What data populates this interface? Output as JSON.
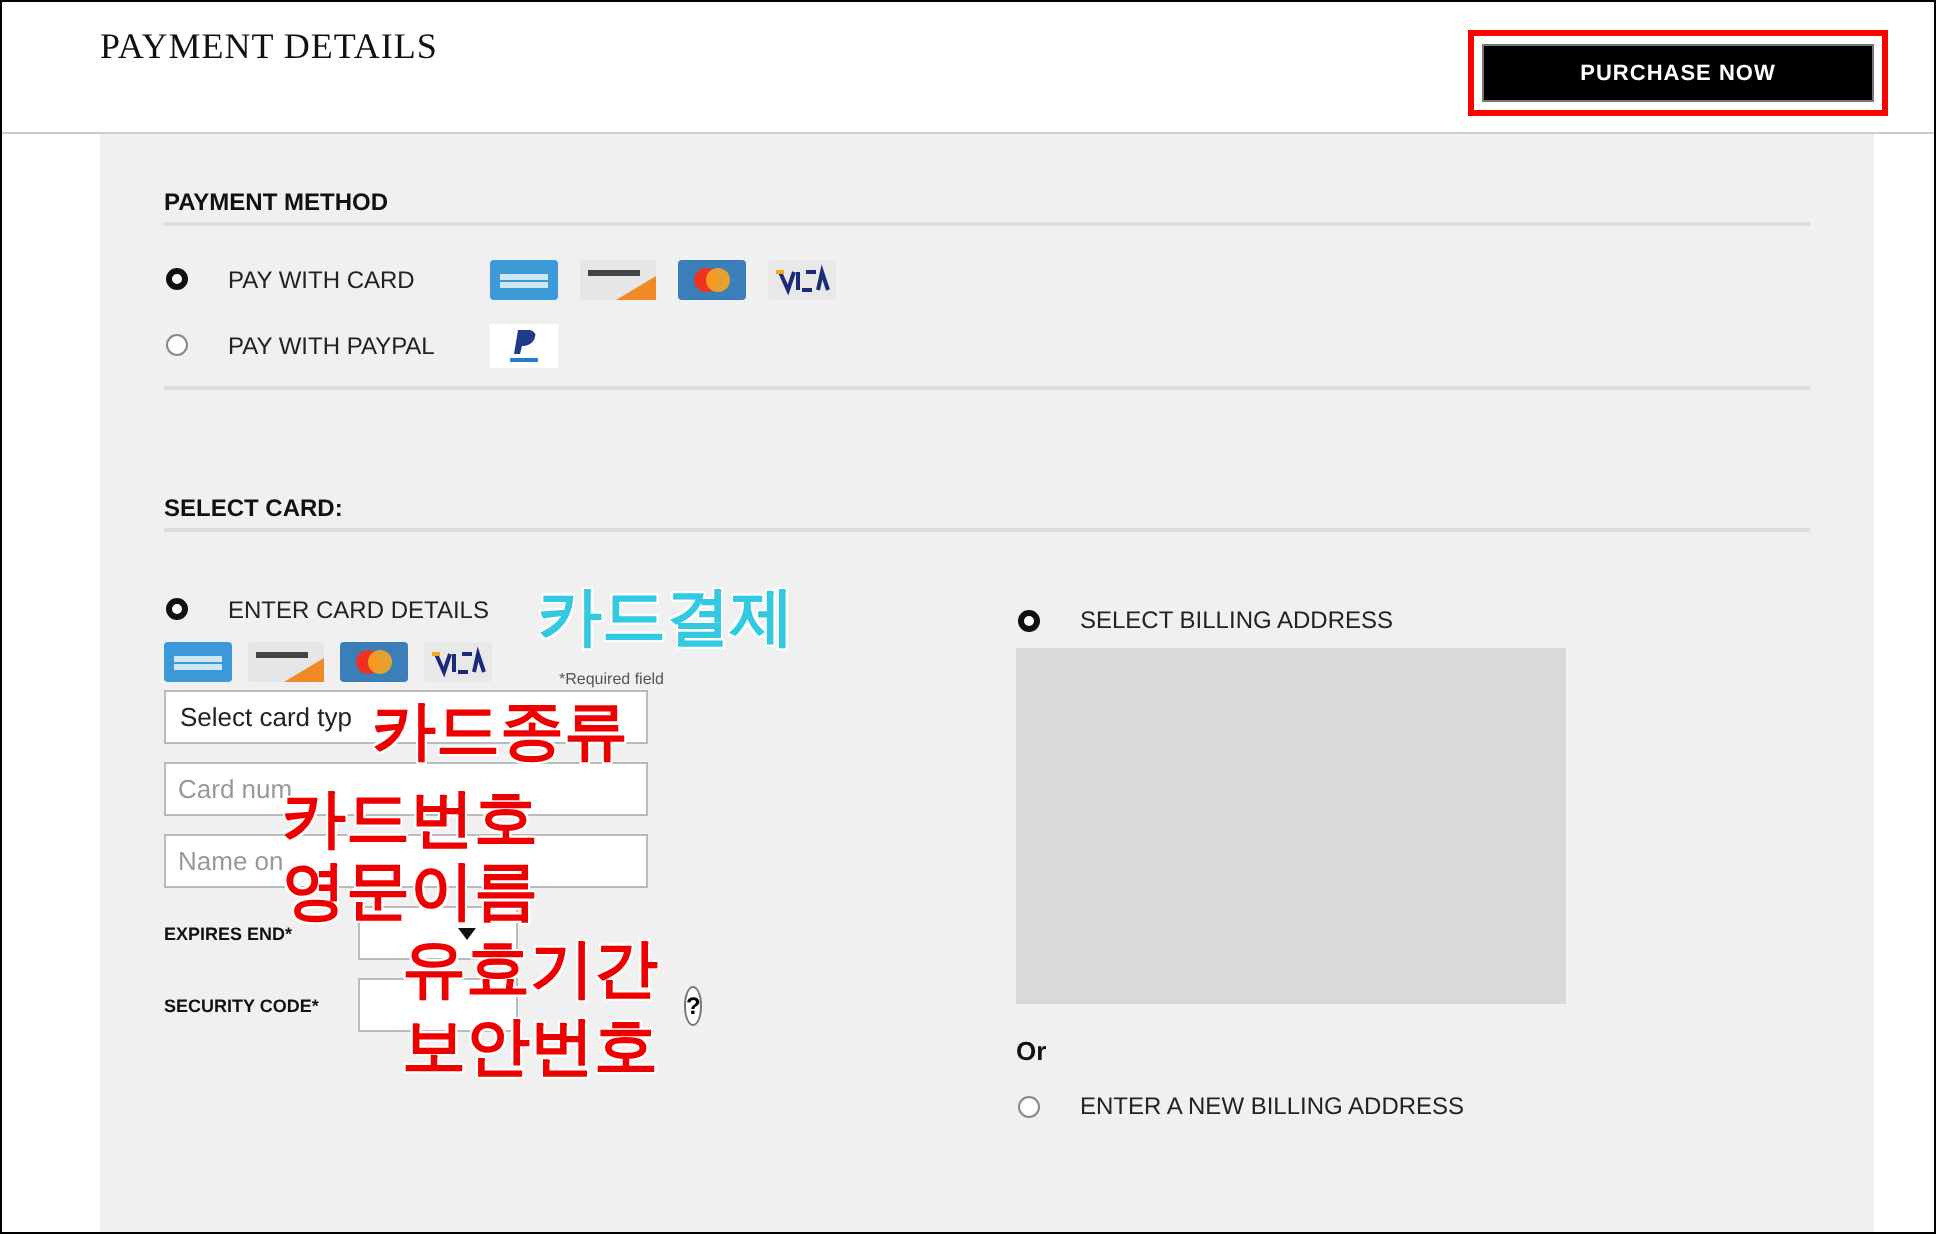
{
  "header": {
    "title": "PAYMENT DETAILS",
    "purchase_button": "PURCHASE NOW",
    "highlighted": true
  },
  "payment_method": {
    "heading": "PAYMENT METHOD",
    "options": [
      {
        "label": "PAY WITH CARD",
        "selected": true,
        "logos": [
          {
            "kind": "amex"
          },
          {
            "kind": "discover"
          },
          {
            "kind": "mastercard"
          },
          {
            "kind": "visa"
          }
        ]
      },
      {
        "label": "PAY WITH PAYPAL",
        "selected": false,
        "logos": [
          {
            "kind": "paypal"
          }
        ]
      }
    ]
  },
  "select_card": {
    "heading": "SELECT CARD:",
    "enter_details": {
      "label": "ENTER CARD DETAILS",
      "selected": true
    },
    "logos": [
      {
        "kind": "amex"
      },
      {
        "kind": "discover"
      },
      {
        "kind": "mastercard"
      },
      {
        "kind": "visa"
      }
    ],
    "required_note": "*Required field",
    "card_type": {
      "value": "Select card typ"
    },
    "card_number": {
      "placeholder": "Card num"
    },
    "name_on_card": {
      "placeholder": "Name on"
    },
    "expires_label": "EXPIRES END*",
    "security_label": "SECURITY CODE*",
    "help": "?"
  },
  "billing": {
    "options": [
      {
        "label": "SELECT BILLING ADDRESS",
        "selected": true
      },
      {
        "label": "ENTER A NEW BILLING ADDRESS",
        "selected": false
      }
    ],
    "or": "Or"
  },
  "annotations": [
    {
      "text": "카드결제",
      "color": "#33c9e0"
    },
    {
      "text": "카드종류",
      "color": "#ee0000"
    },
    {
      "text": "카드번호",
      "color": "#ee0000"
    },
    {
      "text": "영문이름",
      "color": "#ee0000"
    },
    {
      "text": "유효기간",
      "color": "#ee0000"
    },
    {
      "text": "보안번호",
      "color": "#ee0000"
    }
  ]
}
